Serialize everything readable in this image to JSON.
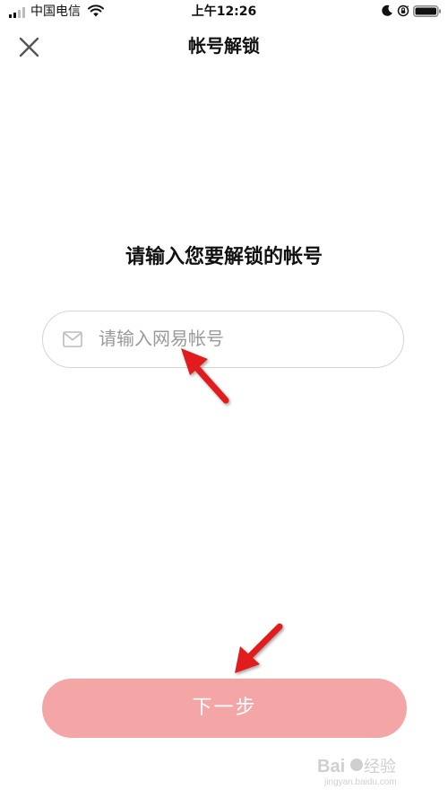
{
  "status_bar": {
    "carrier": "中国电信",
    "time": "上午12:26"
  },
  "nav": {
    "title": "帐号解锁",
    "close_icon": "close-icon"
  },
  "main": {
    "prompt": "请输入您要解锁的帐号",
    "account_field": {
      "icon": "mail-icon",
      "value": "",
      "placeholder": "请输入网易帐号"
    },
    "next_button_label": "下一步"
  },
  "watermark": {
    "text": "Baidu 经验",
    "subtext": "jingyan.baidu.com"
  },
  "colors": {
    "button_bg": "#f4a5a5",
    "button_text": "#ffffff",
    "field_border": "#d5d5d5",
    "placeholder": "#9a9a9a",
    "annotation_arrow": "#e01b1b"
  }
}
